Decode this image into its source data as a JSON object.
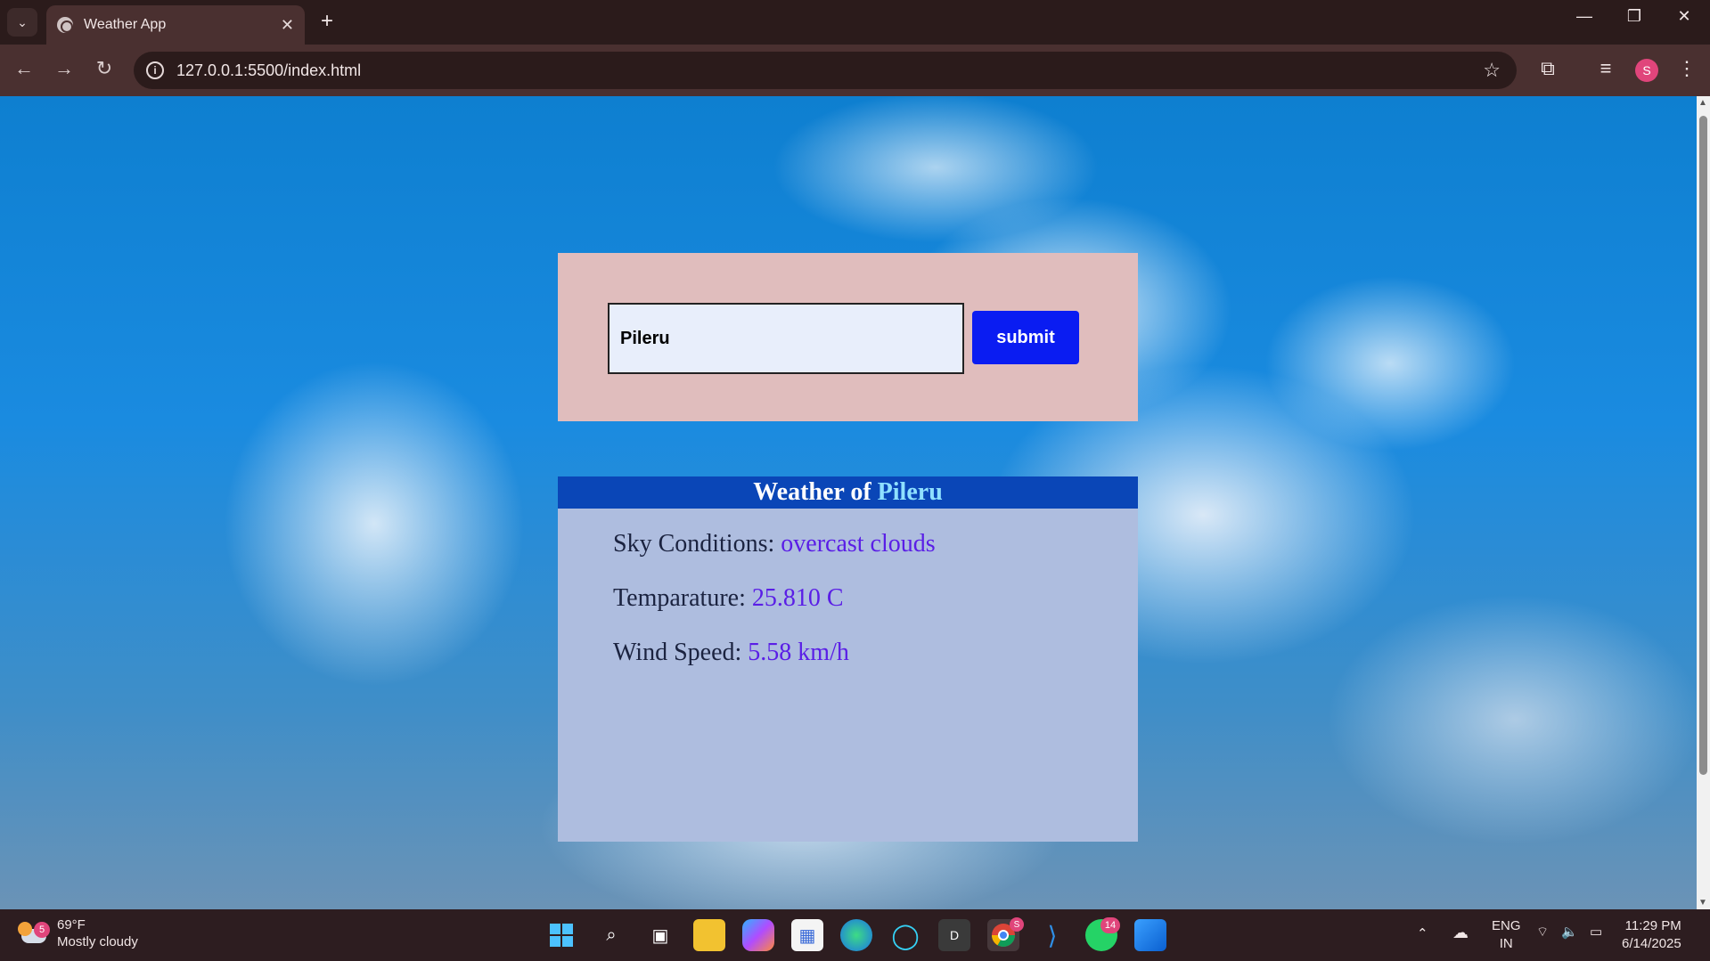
{
  "browser": {
    "tab_title": "Weather App",
    "url": "127.0.0.1:5500/index.html",
    "profile_initial": "S"
  },
  "app": {
    "search": {
      "input_value": "Pileru",
      "submit_label": "submit"
    },
    "weather": {
      "header_prefix": "Weather of",
      "city": "Pileru",
      "sky_label": "Sky Conditions:",
      "sky_value": "overcast clouds",
      "temp_label": "Temparature:",
      "temp_value": "25.810 C",
      "wind_label": "Wind Speed:",
      "wind_value": "5.58 km/h"
    }
  },
  "taskbar": {
    "weather_badge": "5",
    "weather_temp": "69°F",
    "weather_desc": "Mostly cloudy",
    "whatsapp_badge": "14",
    "chrome_badge": "S",
    "lang_1": "ENG",
    "lang_2": "IN",
    "time": "11:29 PM",
    "date": "6/14/2025"
  },
  "colors": {
    "search_card": "#e0bdbd",
    "weather_card": "#aebddf",
    "weather_header": "#0a46b7",
    "submit_button": "#0a1cf2",
    "value_text": "#5a1ee6"
  }
}
